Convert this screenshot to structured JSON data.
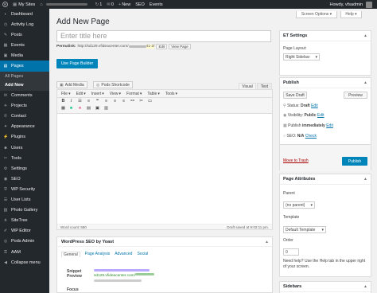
{
  "admin_bar": {
    "my_sites": "My Sites",
    "updates": "1",
    "comments": "0",
    "new": "New",
    "seo": "SEO",
    "events": "Events",
    "howdy": "Howdy, vfsadmin"
  },
  "sidebar": {
    "items": [
      {
        "icon": "dashboard-icon",
        "glyph": "◐",
        "label": "Dashboard"
      },
      {
        "icon": "activity-log-icon",
        "glyph": "◷",
        "label": "Activity Log"
      },
      {
        "icon": "posts-icon",
        "glyph": "✎",
        "label": "Posts"
      },
      {
        "icon": "events-icon",
        "glyph": "▦",
        "label": "Events"
      },
      {
        "icon": "media-icon",
        "glyph": "▣",
        "label": "Media"
      },
      {
        "icon": "pages-icon",
        "glyph": "▤",
        "label": "Pages"
      }
    ],
    "pages_sub": [
      "All Pages",
      "Add New"
    ],
    "items2": [
      {
        "icon": "comments-icon",
        "glyph": "✉",
        "label": "Comments"
      },
      {
        "icon": "projects-icon",
        "glyph": "✈",
        "label": "Projects"
      },
      {
        "icon": "contact-icon",
        "glyph": "✆",
        "label": "Contact"
      },
      {
        "icon": "appearance-icon",
        "glyph": "✦",
        "label": "Appearance"
      },
      {
        "icon": "plugins-icon",
        "glyph": "⚡",
        "label": "Plugins"
      },
      {
        "icon": "users-icon",
        "glyph": "☻",
        "label": "Users"
      },
      {
        "icon": "tools-icon",
        "glyph": "✂",
        "label": "Tools"
      },
      {
        "icon": "settings-icon",
        "glyph": "⚙",
        "label": "Settings"
      },
      {
        "icon": "seo-icon",
        "glyph": "◉",
        "label": "SEO"
      },
      {
        "icon": "wp-security-icon",
        "glyph": "⛨",
        "label": "WP Security"
      },
      {
        "icon": "user-lists-icon",
        "glyph": "☰",
        "label": "User Lists"
      },
      {
        "icon": "photo-gallery-icon",
        "glyph": "▧",
        "label": "Photo Gallery"
      },
      {
        "icon": "sitetree-icon",
        "glyph": "⋔",
        "label": "SiteTree"
      },
      {
        "icon": "wp-editor-icon",
        "glyph": "✐",
        "label": "WP Editor"
      },
      {
        "icon": "pods-admin-icon",
        "glyph": "◎",
        "label": "Pods Admin"
      },
      {
        "icon": "aam-icon",
        "glyph": "⚿",
        "label": "AAM"
      },
      {
        "icon": "collapse-menu-icon",
        "glyph": "◀",
        "label": "Collapse menu"
      }
    ]
  },
  "header": {
    "title": "Add New Page",
    "screen_options": "Screen Options ▾",
    "help": "Help ▾"
  },
  "editor": {
    "title_placeholder": "Enter title here",
    "permalink_label": "Permalink:",
    "permalink_url": "http://sd129.vfideacenter.com/",
    "permalink_slug": "41-2/",
    "edit_btn": "Edit",
    "view_page_btn": "View Page",
    "page_builder_btn": "Use Page Builder",
    "add_media": "Add Media",
    "pods_shortcode": "Pods Shortcode",
    "tab_visual": "Visual",
    "tab_text": "Text",
    "menubar": [
      "File",
      "Edit",
      "Insert",
      "View",
      "Format",
      "Table",
      "Tools"
    ],
    "word_count": "Word count: 580",
    "draft_saved": "Draft saved at 9:02:11 pm."
  },
  "seo_box": {
    "title": "WordPress SEO by Yoast",
    "tabs": [
      "General",
      "Page Analysis",
      "Advanced",
      "Social"
    ],
    "snippet_preview": "Snippet Preview",
    "snippet_url": "sd129.vfideacenter.com/",
    "focus": "Focus"
  },
  "et_settings": {
    "title": "ET Settings",
    "page_layout_label": "Page Layout:",
    "page_layout_value": "Right Sidebar"
  },
  "publish": {
    "title": "Publish",
    "save_draft": "Save Draft",
    "preview": "Preview",
    "status_label": "Status:",
    "status_value": "Draft",
    "visibility_label": "Visibility:",
    "visibility_value": "Public",
    "publish_label": "Publish",
    "publish_value": "immediately",
    "seo_label": "SEO:",
    "seo_value": "N/A",
    "check": "Check",
    "edit": "Edit",
    "trash": "Move to Trash",
    "publish_btn": "Publish"
  },
  "page_attributes": {
    "title": "Page Attributes",
    "parent_label": "Parent",
    "parent_value": "(no parent)",
    "template_label": "Template",
    "template_value": "Default Template",
    "order_label": "Order",
    "order_value": "0",
    "help_text": "Need help? Use the Help tab in the upper right of your screen."
  },
  "sidebars": {
    "title": "Sidebars"
  },
  "colors": {
    "accent": "#0073aa",
    "button": "#0085ba",
    "admin_bar": "#23282d"
  }
}
